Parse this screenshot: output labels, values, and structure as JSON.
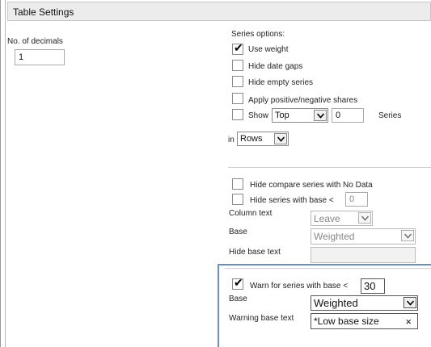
{
  "header": {
    "title": "Table Settings"
  },
  "decimals": {
    "label": "No. of decimals",
    "value": "1"
  },
  "series_options": {
    "title": "Series options:",
    "use_weight": {
      "label": "Use weight",
      "checked": true
    },
    "hide_date_gaps": {
      "label": "Hide date gaps",
      "checked": false
    },
    "hide_empty_series": {
      "label": "Hide empty series",
      "checked": false
    },
    "apply_shares": {
      "label": "Apply positive/negative shares",
      "checked": false
    },
    "show": {
      "label": "Show",
      "select_value": "Top",
      "count": "0",
      "suffix": "Series",
      "checked": false
    },
    "in": {
      "label": "in",
      "select_value": "Rows"
    }
  },
  "compare": {
    "hide_no_data": {
      "label": "Hide compare series with No Data",
      "checked": false
    },
    "hide_base": {
      "label": "Hide series with base <",
      "value": "0",
      "checked": false
    },
    "column_text": {
      "label": "Column text",
      "value": "Leave"
    },
    "base": {
      "label": "Base",
      "value": "Weighted"
    },
    "hide_base_text": {
      "label": "Hide base text",
      "value": ""
    }
  },
  "warn": {
    "warn_base": {
      "label": "Warn for series with base <",
      "value": "30",
      "checked": true
    },
    "base": {
      "label": "Base",
      "value": "Weighted"
    },
    "warning_text": {
      "label": "Warning base text",
      "value": "*Low base size",
      "clear": "×"
    }
  }
}
